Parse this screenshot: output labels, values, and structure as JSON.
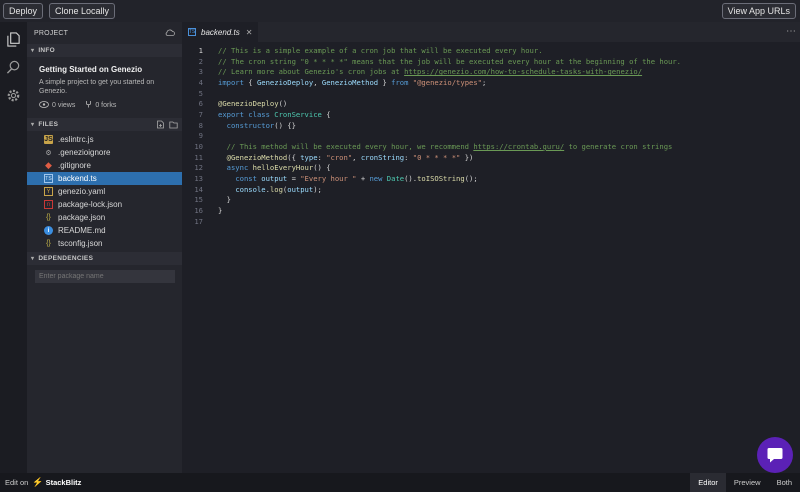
{
  "topbar": {
    "deploy": "Deploy",
    "clone": "Clone Locally",
    "view_urls": "View App URLs"
  },
  "sidebar": {
    "header": "PROJECT",
    "info_title": "INFO",
    "project_name": "Getting Started on Genezio",
    "project_desc": "A simple project to get you started on Genezio.",
    "views": "0 views",
    "forks": "0 forks",
    "files_title": "FILES",
    "files": [
      {
        "name": ".eslintrc.js",
        "icon": "eslint-icon"
      },
      {
        "name": ".genezioignore",
        "icon": "gear-icon"
      },
      {
        "name": ".gitignore",
        "icon": "git-icon"
      },
      {
        "name": "backend.ts",
        "icon": "typescript-icon",
        "active": true
      },
      {
        "name": "genezio.yaml",
        "icon": "yaml-icon"
      },
      {
        "name": "package-lock.json",
        "icon": "npm-icon"
      },
      {
        "name": "package.json",
        "icon": "json-icon"
      },
      {
        "name": "README.md",
        "icon": "info-icon"
      },
      {
        "name": "tsconfig.json",
        "icon": "json-icon"
      }
    ],
    "deps_title": "DEPENDENCIES",
    "pkg_placeholder": "Enter package name"
  },
  "editor": {
    "tab": "backend.ts",
    "lines": [
      "1",
      "2",
      "3",
      "4",
      "5",
      "6",
      "7",
      "8",
      "9",
      "10",
      "11",
      "12",
      "13",
      "14",
      "15",
      "16",
      "17"
    ]
  },
  "bottombar": {
    "edit_on": "Edit on",
    "brand": "StackBlitz",
    "tabs": [
      "Editor",
      "Preview",
      "Both"
    ],
    "active_tab": "Editor"
  },
  "colors": {
    "accent": "#2d6fae",
    "chat": "#5b21b6",
    "comment": "#6a9955",
    "keyword": "#569cd6"
  }
}
